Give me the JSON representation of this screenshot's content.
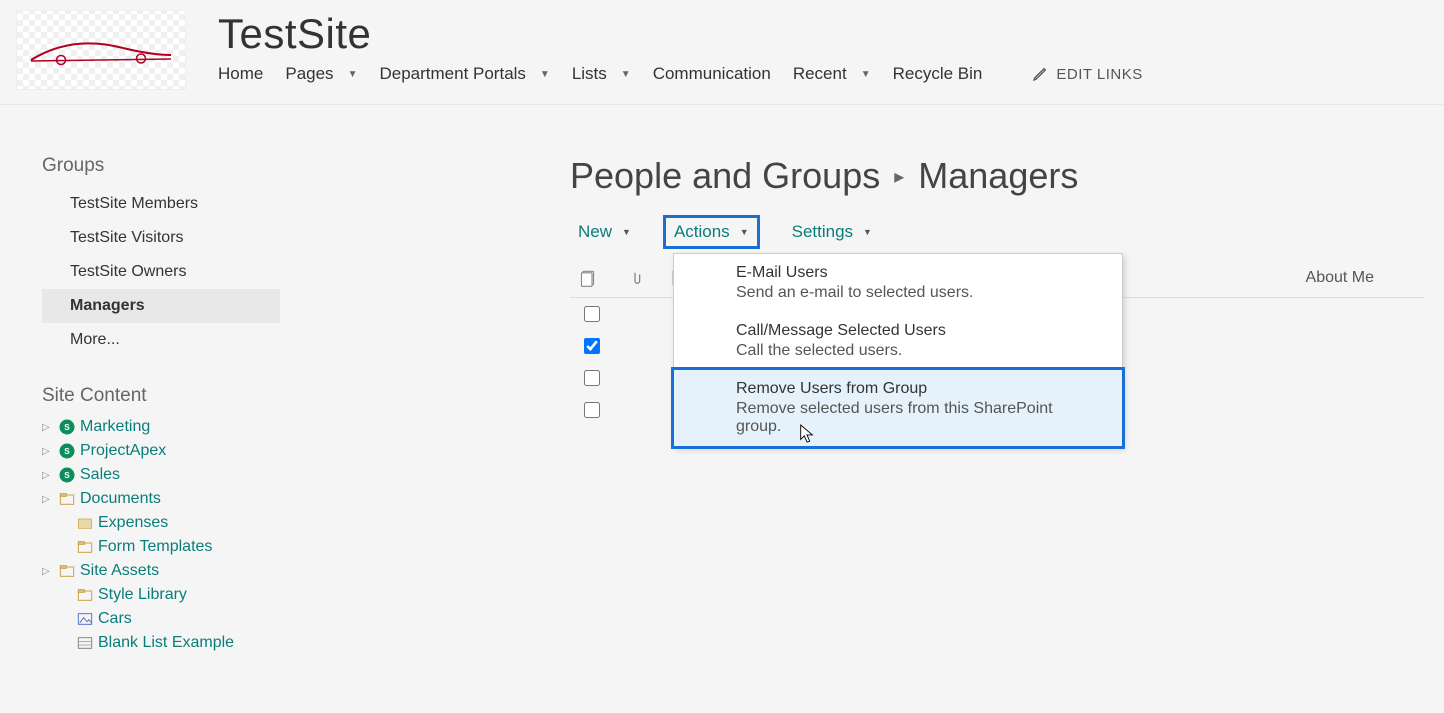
{
  "header": {
    "site_title": "TestSite",
    "nav": [
      "Home",
      "Pages",
      "Department Portals",
      "Lists",
      "Communication",
      "Recent",
      "Recycle Bin"
    ],
    "nav_has_caret": [
      false,
      true,
      true,
      true,
      false,
      true,
      false
    ],
    "edit_links": "EDIT LINKS"
  },
  "sidebar": {
    "groups_heading": "Groups",
    "groups": [
      {
        "label": "TestSite Members",
        "active": false
      },
      {
        "label": "TestSite Visitors",
        "active": false
      },
      {
        "label": "TestSite Owners",
        "active": false
      },
      {
        "label": "Managers",
        "active": true
      },
      {
        "label": "More...",
        "active": false
      }
    ],
    "site_content_heading": "Site Content",
    "tree": [
      {
        "label": "Marketing",
        "icon": "sp",
        "expand": true,
        "indent": 0
      },
      {
        "label": "ProjectApex",
        "icon": "sp",
        "expand": true,
        "indent": 0
      },
      {
        "label": "Sales",
        "icon": "sp",
        "expand": true,
        "indent": 0
      },
      {
        "label": "Documents",
        "icon": "folder",
        "expand": true,
        "indent": 0
      },
      {
        "label": "Expenses",
        "icon": "doclib",
        "expand": false,
        "indent": 1
      },
      {
        "label": "Form Templates",
        "icon": "folder",
        "expand": false,
        "indent": 1
      },
      {
        "label": "Site Assets",
        "icon": "folder",
        "expand": true,
        "indent": 0
      },
      {
        "label": "Style Library",
        "icon": "folder",
        "expand": false,
        "indent": 1
      },
      {
        "label": "Cars",
        "icon": "pic",
        "expand": false,
        "indent": 1
      },
      {
        "label": "Blank List Example",
        "icon": "list",
        "expand": false,
        "indent": 1
      }
    ]
  },
  "page": {
    "title_prefix": "People and Groups",
    "title_group": "Managers",
    "toolbar": {
      "new": "New",
      "actions": "Actions",
      "settings": "Settings"
    },
    "columns": {
      "about_me": "About Me"
    },
    "rows": [
      {
        "checked": false
      },
      {
        "checked": true
      },
      {
        "checked": false
      },
      {
        "checked": false
      }
    ],
    "dropdown": [
      {
        "title": "E-Mail Users",
        "desc": "Send an e-mail to selected users.",
        "hover": false
      },
      {
        "title": "Call/Message Selected Users",
        "desc": "Call the selected users.",
        "hover": false
      },
      {
        "title": "Remove Users from Group",
        "desc": "Remove selected users from this SharePoint group.",
        "hover": true
      }
    ]
  }
}
